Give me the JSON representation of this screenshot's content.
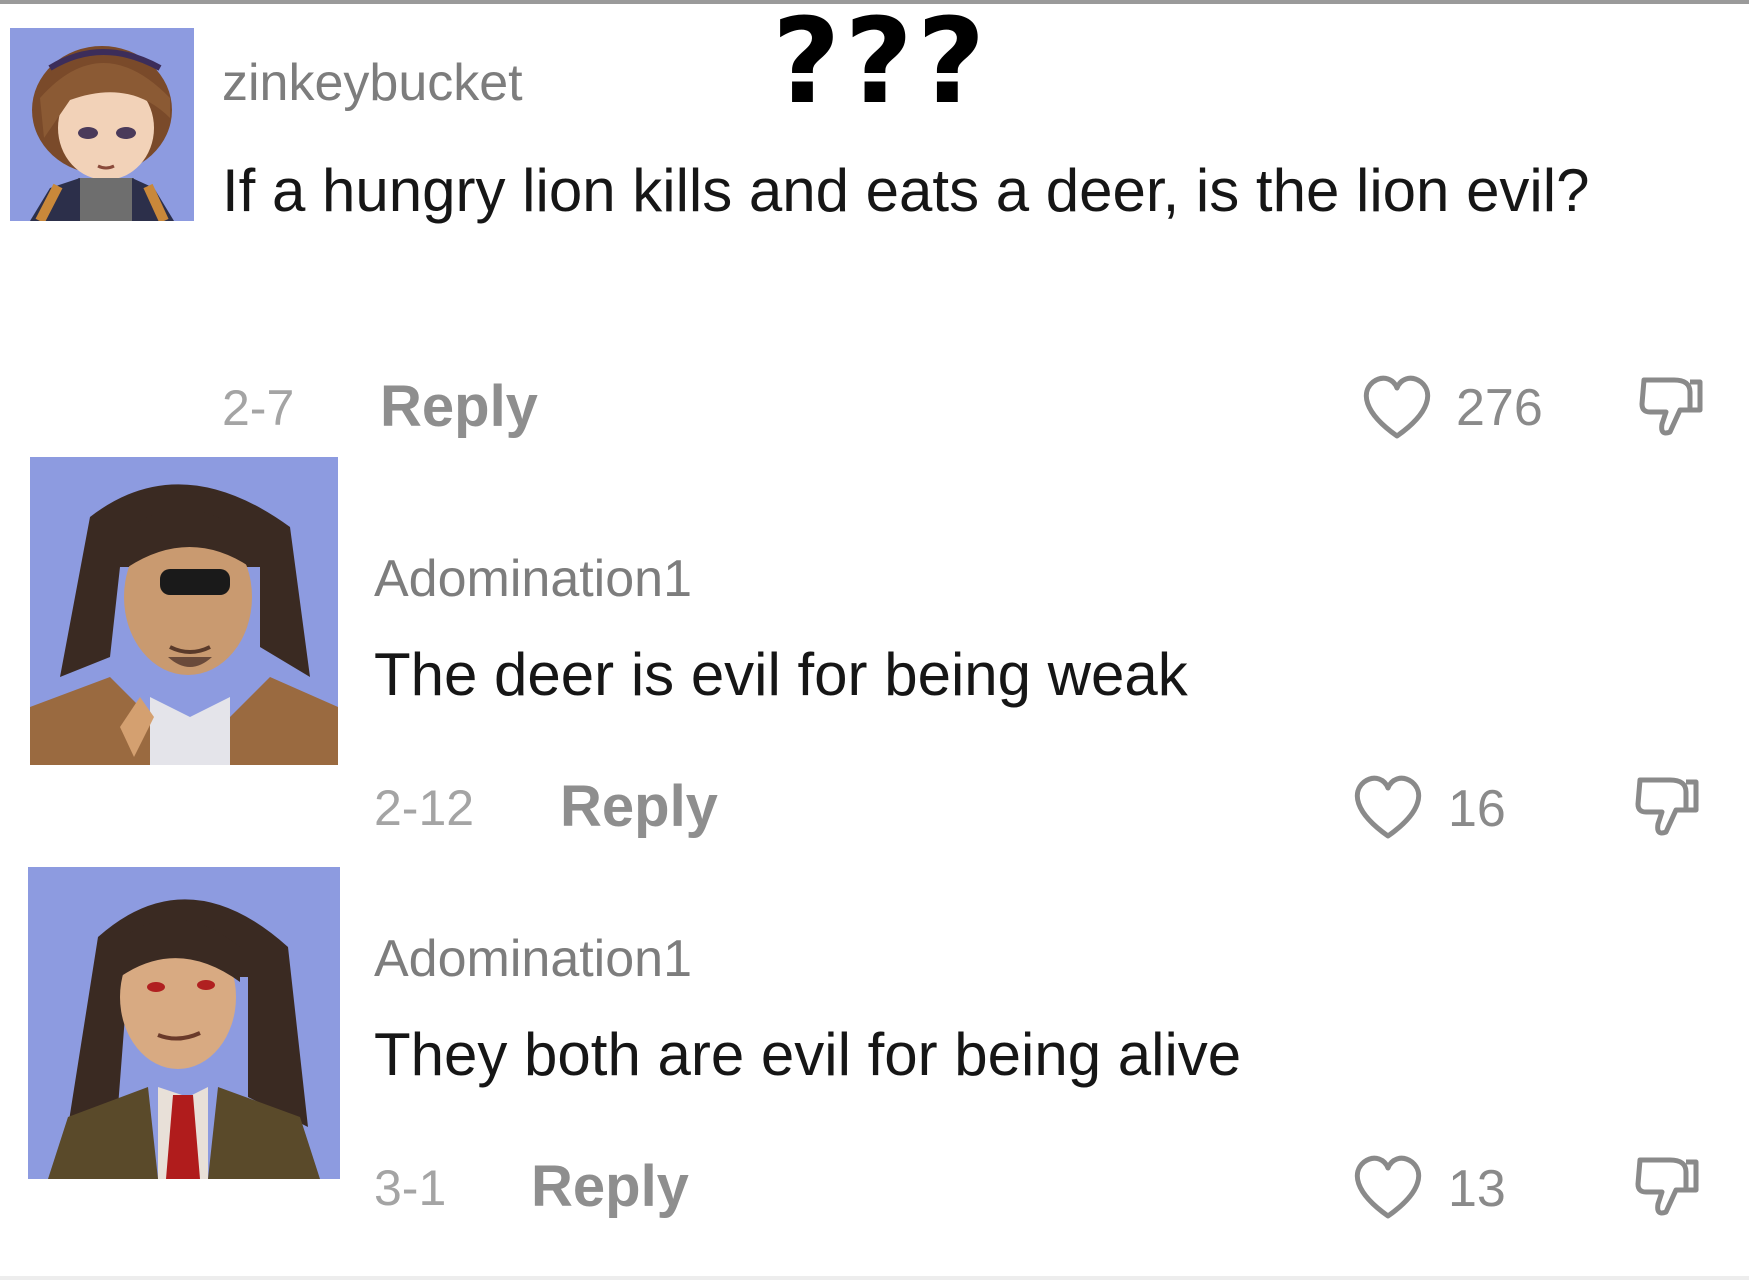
{
  "overlay": {
    "text": "???"
  },
  "comments": [
    {
      "username": "zinkeybucket",
      "text": "If a hungry lion kills and eats a deer, is the lion evil?",
      "date": "2-7",
      "reply_label": "Reply",
      "likes": "276",
      "like_icon": "heart-outline-icon",
      "dislike_icon": "thumbs-down-icon"
    },
    {
      "username": "Adomination1",
      "text": "The deer is evil for being weak",
      "date": "2-12",
      "reply_label": "Reply",
      "likes": "16",
      "like_icon": "heart-outline-icon",
      "dislike_icon": "thumbs-down-icon"
    },
    {
      "username": "Adomination1",
      "text": "They both are evil for being alive",
      "date": "3-1",
      "reply_label": "Reply",
      "likes": "13",
      "like_icon": "heart-outline-icon",
      "dislike_icon": "thumbs-down-icon"
    }
  ],
  "colors": {
    "username": "#7d7d7d",
    "text": "#161616",
    "meta": "#a4a4a4",
    "avatar_background": "#8d9be0"
  }
}
